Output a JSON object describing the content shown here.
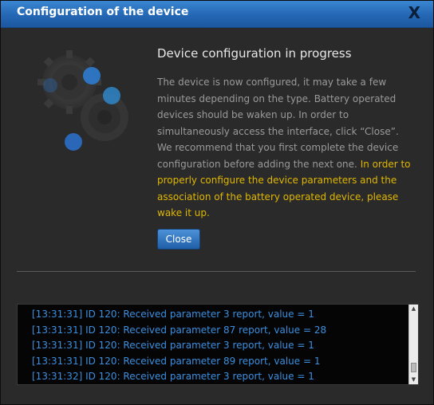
{
  "dialog": {
    "title": "Configuration of the device",
    "close_icon": "X",
    "heading": "Device configuration in progress",
    "description": "The device is now configured, it may take a few minutes depending on the type. Battery operated devices should be waken up. In order to simultaneously access the interface, click “Close”. We recommend that you first complete the device configuration before adding the next one.",
    "warning": "In order to properly configure the device parameters and the association of the battery operated device, please wake it up.",
    "close_button": "Close",
    "image_icon": "gears-icon"
  },
  "log": {
    "lines": [
      "[13:31:31] ID 120: Received parameter 3 report, value = 1",
      "[13:31:31] ID 120: Received parameter 87 report, value = 28",
      "[13:31:31] ID 120: Received parameter 3 report, value = 1",
      "[13:31:31] ID 120: Received parameter 89 report, value = 1",
      "[13:31:32] ID 120: Received parameter 3 report, value = 1"
    ]
  },
  "colors": {
    "titlebar": "#2467b4",
    "text_muted": "#9a9a9a",
    "warning": "#e0b700",
    "log_text": "#3b8fe0"
  }
}
